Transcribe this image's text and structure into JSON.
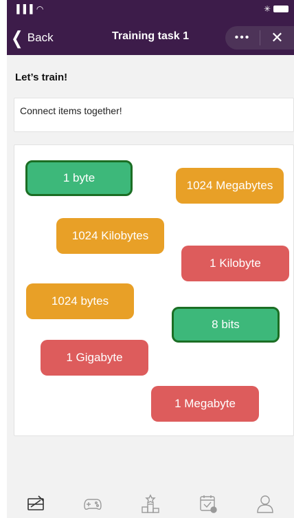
{
  "status": {
    "signal": "▐▐▐ ◠",
    "bluetooth": "✳"
  },
  "header": {
    "back_label": "Back",
    "title": "Training task 1",
    "more_label": "•••",
    "close_label": "✕"
  },
  "section_title": "Let’s train!",
  "instruction": "Connect items together!",
  "tiles": [
    {
      "label": "1 byte",
      "color": "green"
    },
    {
      "label": "1024 Megabytes",
      "color": "orange"
    },
    {
      "label": "1024 Kilobytes",
      "color": "orange"
    },
    {
      "label": "1 Kilobyte",
      "color": "red"
    },
    {
      "label": "1024 bytes",
      "color": "orange"
    },
    {
      "label": "8 bits",
      "color": "green"
    },
    {
      "label": "1 Gigabyte",
      "color": "red"
    },
    {
      "label": "1 Megabyte",
      "color": "red"
    }
  ],
  "nav": [
    "learn-icon",
    "games-icon",
    "leaderboard-icon",
    "calendar-icon",
    "profile-icon"
  ],
  "colors": {
    "header": "#3d1c4a",
    "orange": "#e8a027",
    "red": "#dd5c5c",
    "green": "#3db87a",
    "green_border": "#1b6e24"
  }
}
